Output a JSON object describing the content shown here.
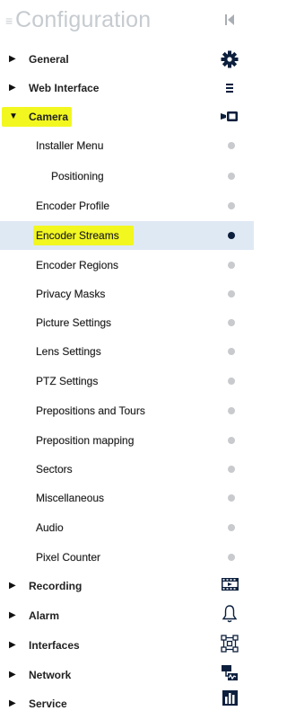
{
  "header": {
    "title": "Configuration"
  },
  "menu": {
    "general": {
      "label": "General"
    },
    "web_interface": {
      "label": "Web Interface"
    },
    "camera": {
      "label": "Camera"
    },
    "recording": {
      "label": "Recording"
    },
    "alarm": {
      "label": "Alarm"
    },
    "interfaces": {
      "label": "Interfaces"
    },
    "network": {
      "label": "Network"
    },
    "service": {
      "label": "Service"
    }
  },
  "camera_items": {
    "installer_menu": "Installer Menu",
    "positioning": "Positioning",
    "encoder_profile": "Encoder Profile",
    "encoder_streams": "Encoder Streams",
    "encoder_regions": "Encoder Regions",
    "privacy_masks": "Privacy Masks",
    "picture_settings": "Picture Settings",
    "lens_settings": "Lens Settings",
    "ptz_settings": "PTZ Settings",
    "prepositions_and_tours": "Prepositions and Tours",
    "preposition_mapping": "Preposition mapping",
    "sectors": "Sectors",
    "miscellaneous": "Miscellaneous",
    "audio": "Audio",
    "pixel_counter": "Pixel Counter"
  },
  "selected_item": "Encoder Streams",
  "colors": {
    "highlight": "#f2f720",
    "selected_row": "#dfe9f4",
    "active_dot": "#0c1f3d",
    "inactive_dot": "#c8cacd",
    "header_text": "#c6cbd0"
  }
}
